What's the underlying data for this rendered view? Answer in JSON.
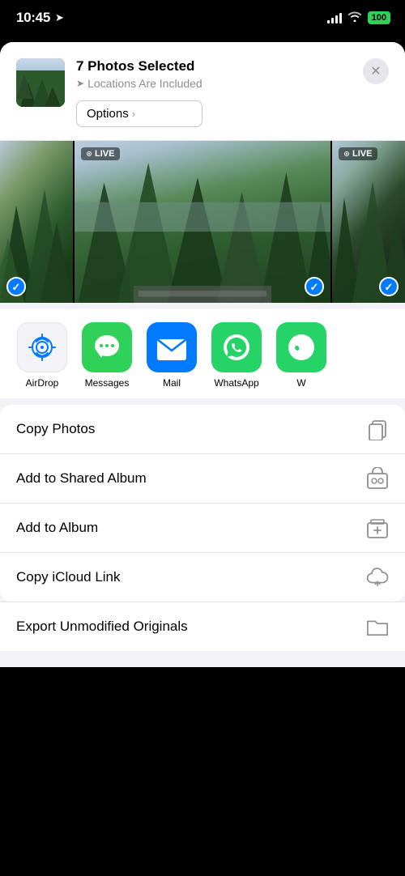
{
  "statusBar": {
    "time": "10:45",
    "batteryPercent": "100"
  },
  "shareHeader": {
    "title": "7 Photos Selected",
    "subtitle": "Locations Are Included",
    "optionsLabel": "Options",
    "optionsChevron": "›"
  },
  "photosStrip": {
    "items": [
      {
        "type": "partial",
        "hasCheck": true,
        "checkPos": "left"
      },
      {
        "type": "wide",
        "hasLive": true,
        "hasCheck": true,
        "checkPos": "right"
      },
      {
        "type": "partial",
        "hasLive": true,
        "hasCheck": true,
        "checkPos": "right"
      }
    ]
  },
  "shareIcons": [
    {
      "id": "airdrop",
      "label": "AirDrop",
      "type": "airdrop"
    },
    {
      "id": "messages",
      "label": "Messages",
      "type": "messages"
    },
    {
      "id": "mail",
      "label": "Mail",
      "type": "mail"
    },
    {
      "id": "whatsapp",
      "label": "WhatsApp",
      "type": "whatsapp"
    },
    {
      "id": "w2",
      "label": "W",
      "type": "more"
    }
  ],
  "actionItems": [
    {
      "id": "copy-photos",
      "label": "Copy Photos",
      "icon": "copy"
    },
    {
      "id": "add-shared-album",
      "label": "Add to Shared Album",
      "icon": "shared-album"
    },
    {
      "id": "add-album",
      "label": "Add to Album",
      "icon": "album"
    },
    {
      "id": "copy-icloud",
      "label": "Copy iCloud Link",
      "icon": "cloud"
    }
  ],
  "partialItem": {
    "label": "Export Unmodified Originals",
    "icon": "folder"
  }
}
